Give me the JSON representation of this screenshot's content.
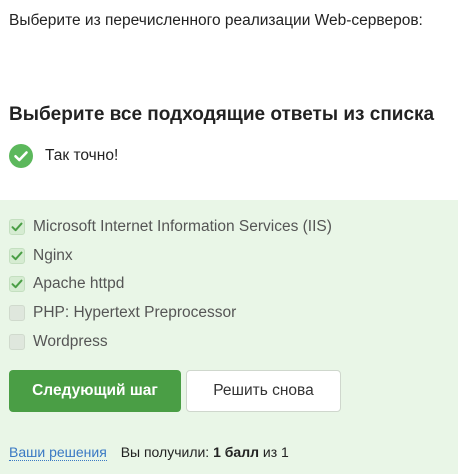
{
  "question": {
    "text": "Выберите из перечисленного реализации Web-серверов:"
  },
  "section": {
    "title": "Выберите все подходящие ответы из списка"
  },
  "feedback": {
    "icon": "check-circle-icon",
    "color": "#5cb85c",
    "text": "Так точно!"
  },
  "options": [
    {
      "label": "Microsoft Internet Information Services (IIS)",
      "checked": true
    },
    {
      "label": "Nginx",
      "checked": true
    },
    {
      "label": "Apache httpd",
      "checked": true
    },
    {
      "label": "PHP: Hypertext Preprocessor",
      "checked": false
    },
    {
      "label": "Wordpress",
      "checked": false
    }
  ],
  "buttons": {
    "next_label": "Следующий шаг",
    "retry_label": "Решить снова"
  },
  "footer": {
    "solutions_link": "Ваши решения",
    "score_prefix": "Вы получили:",
    "score_value": "1 балл",
    "score_suffix": "из 1"
  },
  "colors": {
    "accent": "#4a9e45",
    "panel_bg": "#e9f6e7",
    "link": "#3a79c4"
  }
}
